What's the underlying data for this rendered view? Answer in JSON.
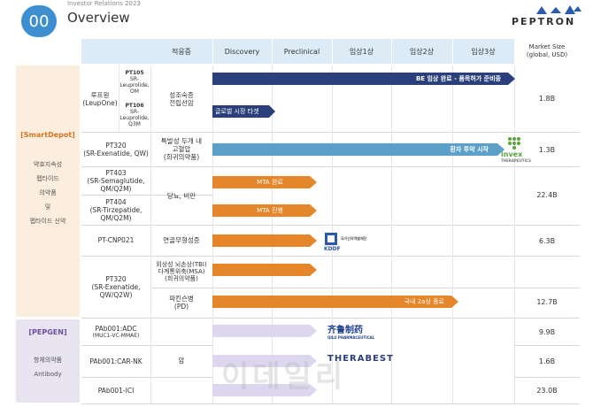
{
  "header": {
    "badge": "00",
    "top_label": "Investor Relations 2023",
    "title": "Overview",
    "logo_text": "PEPTRON"
  },
  "columns": {
    "indication": "적응증",
    "discovery": "Discovery",
    "preclinical": "Preclinical",
    "phase1": "임상1상",
    "phase2": "임상2상",
    "phase3": "임상3상",
    "market_size_line1": "Market Size",
    "market_size_line2": "(global, USD)"
  },
  "platforms": {
    "smartdepot": {
      "title": "[SmartDepot]",
      "desc": [
        "약효지속성",
        "펩타이드",
        "의약품",
        "및",
        "펩타이드 신약"
      ]
    },
    "pepgen": {
      "title": "[PEPGEN]",
      "desc": [
        "항체의약품",
        "Antibody"
      ]
    }
  },
  "rows": {
    "leupone": {
      "name1": "루프원",
      "name2": "(LeupOne)",
      "pt105_code": "PT105",
      "pt105_desc": [
        "SR-",
        "Leuprolide,",
        "OM"
      ],
      "pt106_code": "PT106",
      "pt106_desc": [
        "SR-",
        "Leuprolide,",
        "Q3M"
      ],
      "indication": [
        "성조숙증",
        "전립선암"
      ],
      "bar1_label": "BE 임상 완료 -  품목허가 준비중",
      "bar2_label": "글로벌 시장 타겟",
      "market": "1.8B"
    },
    "pt320a": {
      "name": [
        "PT320",
        "(SR-Exenatide, QW)"
      ],
      "indication": [
        "특발성 두개 내",
        "고혈압",
        "(희귀의약품)"
      ],
      "bar_label": "환자 투약 시작",
      "partner": "invex",
      "partner_sub": "THERAPEUTICS",
      "market": "1.3B"
    },
    "pt403": {
      "name": [
        "PT403",
        "(SR-Semaglutide,",
        "QM/Q2M)"
      ],
      "bar_label": "MTA 완료"
    },
    "pt404": {
      "name": [
        "PT404",
        "(SR-Tirzepatide,",
        "QM/Q2M)"
      ],
      "bar_label": "MTA 진행"
    },
    "obesity": {
      "indication": "당뇨, 비만",
      "market": "22.4B"
    },
    "cnp021": {
      "name": "PT-CNP021",
      "indication": "연골무형성증",
      "partner": "KDDF",
      "partner_sub": "국가신약개발재단",
      "market": "6.3B"
    },
    "pt320b": {
      "name": [
        "PT320",
        "(SR-Exenatide,",
        "QW/Q2W)"
      ],
      "indication_tbi": [
        "외상성 뇌손상(TBI)",
        "다계통위축(MSA)",
        "(희귀의약품)"
      ],
      "indication_pd": [
        "파킨슨병",
        "(PD)"
      ],
      "bar_label": "국내 2a상 종료",
      "market": "12.7B"
    },
    "adc": {
      "name": [
        "PAb001:ADC",
        "(MUC1-VC-MMAE)"
      ],
      "partner": "齐鲁制药",
      "partner_sub": "QILU PHARMACEUTICAL",
      "market": "9.9B"
    },
    "carnk": {
      "name": "PAb001:CAR-NK",
      "indication": "암",
      "partner": "THERABEST",
      "market": "1.6B"
    },
    "ici": {
      "name": "PAb001-ICI",
      "market": "23.0B"
    }
  },
  "watermark": "이데일리",
  "colors": {
    "navy_bar": "#2b3f7a",
    "orange_bar": "#e6862a",
    "blue_bar": "#5aa0c8",
    "lavender_bar": "#dcd6ee",
    "header_fill": "#dcebf5",
    "smartdepot_fill": "#fbeede",
    "pepgen_fill": "#e8e4f1"
  }
}
